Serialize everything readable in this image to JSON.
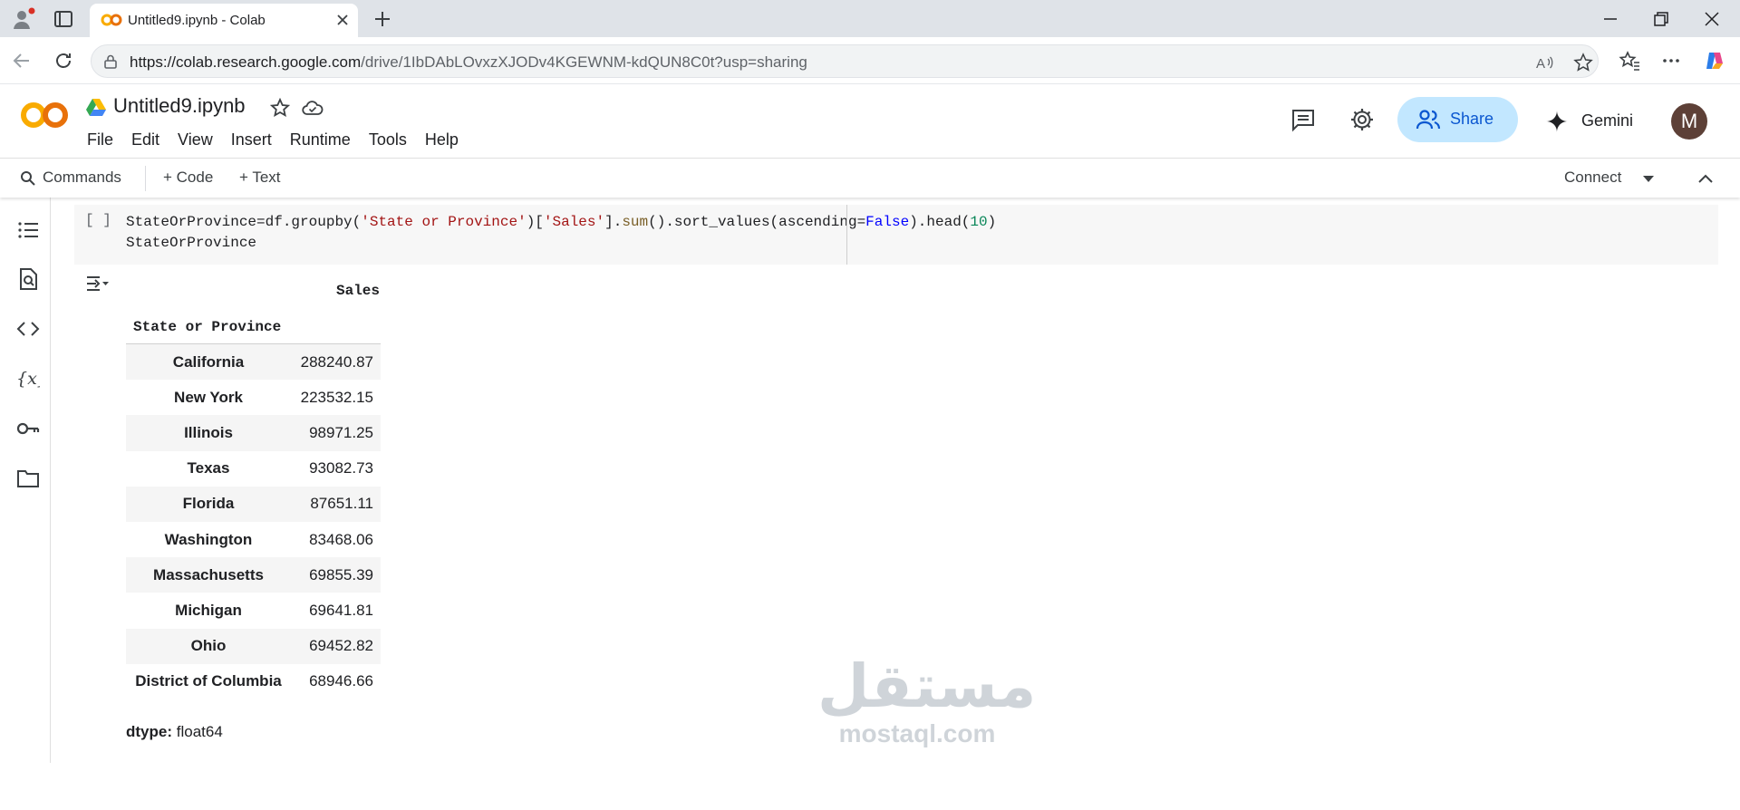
{
  "browser": {
    "tab_title": "Untitled9.ipynb - Colab",
    "url_host": "https://colab.research.google.com",
    "url_path": "/drive/1IbDAbLOvxzXJODv4KGEWNM-kdQUN8C0t?usp=sharing"
  },
  "colab": {
    "notebook_title": "Untitled9.ipynb",
    "logo_text": "CO",
    "menu": [
      "File",
      "Edit",
      "View",
      "Insert",
      "Runtime",
      "Tools",
      "Help"
    ],
    "share_label": "Share",
    "gemini_label": "Gemini",
    "avatar_letter": "M"
  },
  "toolbar": {
    "commands": "Commands",
    "add_code": "+ Code",
    "add_text": "+ Text",
    "connect": "Connect"
  },
  "cell": {
    "run_indicator": "[ ]",
    "code_line1_parts": [
      "StateOrProvince=df.groupby(",
      "'State or Province'",
      ")[",
      "'Sales'",
      "].",
      "sum",
      "().sort_values(ascending=",
      "False",
      ").head(",
      "10",
      ")"
    ],
    "code_line2": "StateOrProvince"
  },
  "output": {
    "column_header": "Sales",
    "index_name": "State or Province",
    "rows": [
      {
        "state": "California",
        "sales": "288240.87"
      },
      {
        "state": "New York",
        "sales": "223532.15"
      },
      {
        "state": "Illinois",
        "sales": "98971.25"
      },
      {
        "state": "Texas",
        "sales": "93082.73"
      },
      {
        "state": "Florida",
        "sales": "87651.11"
      },
      {
        "state": "Washington",
        "sales": "83468.06"
      },
      {
        "state": "Massachusetts",
        "sales": "69855.39"
      },
      {
        "state": "Michigan",
        "sales": "69641.81"
      },
      {
        "state": "Ohio",
        "sales": "69452.82"
      },
      {
        "state": "District of Columbia",
        "sales": "68946.66"
      }
    ],
    "dtype_label": "dtype:",
    "dtype_value": "float64"
  },
  "watermark": {
    "arabic": "مستقل",
    "latin": "mostaql.com"
  },
  "colors": {
    "colab_orange": "#f9ab00",
    "share_bg": "#c2e7ff",
    "share_text": "#0b57d0"
  }
}
